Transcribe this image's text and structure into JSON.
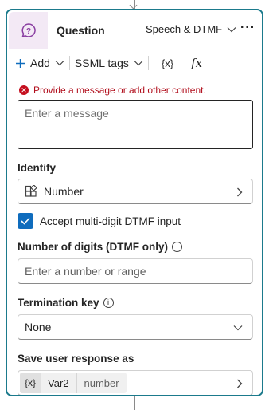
{
  "node": {
    "title": "Question",
    "mode_label": "Speech & DTMF",
    "more_label": "···"
  },
  "toolbar": {
    "add_label": "Add",
    "ssml_label": "SSML tags",
    "variable_label": "{x}",
    "formula_label": "fx"
  },
  "message": {
    "error_text": "Provide a message or add other content.",
    "placeholder": "Enter a message"
  },
  "identify": {
    "label": "Identify",
    "value": "Number"
  },
  "multi_digit": {
    "label": "Accept multi-digit DTMF input",
    "checked": true
  },
  "digits": {
    "label": "Number of digits (DTMF only)",
    "placeholder": "Enter a number or range"
  },
  "termination": {
    "label": "Termination key",
    "value": "None"
  },
  "save_response": {
    "label": "Save user response as",
    "var_icon": "{x}",
    "var_name": "Var2",
    "var_type": "number"
  },
  "colors": {
    "accent_border": "#1b7a8c",
    "icon_bg": "#f3e9f5",
    "error": "#c50f1f",
    "checkbox": "#0f6cbd"
  }
}
